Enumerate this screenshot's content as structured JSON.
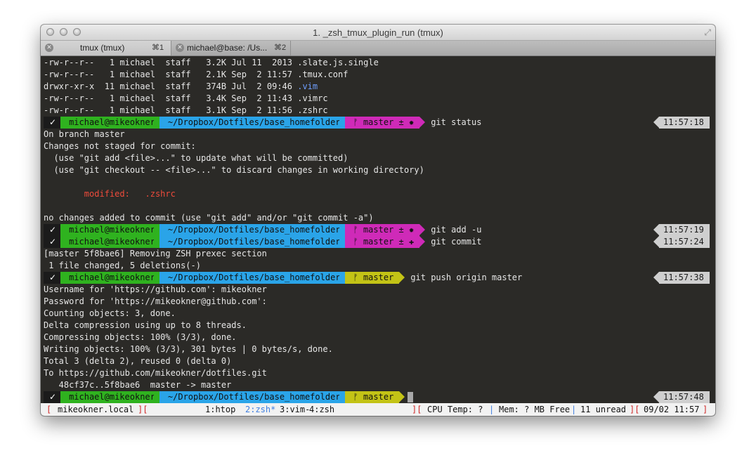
{
  "window": {
    "title": "1. _zsh_tmux_plugin_run (tmux)",
    "tabs": [
      {
        "label": "tmux (tmux)",
        "shortcut": "⌘1"
      },
      {
        "label": "michael@base: /Us...",
        "shortcut": "⌘2"
      }
    ]
  },
  "terminal": {
    "lines_top": [
      "-rw-r--r--   1 michael  staff   3.2K Jul 11  2013 .slate.js.single",
      "-rw-r--r--   1 michael  staff   2.1K Sep  2 11:57 .tmux.conf",
      "drwxr-xr-x  11 michael  staff   374B Jul  2 09:46 ",
      "-rw-r--r--   1 michael  staff   3.4K Sep  2 11:43 .vimrc",
      "-rw-r--r--   1 michael  staff   3.1K Sep  2 11:56 .zshrc"
    ],
    "vim_dir": ".vim",
    "status_output": [
      "On branch master",
      "Changes not staged for commit:",
      "  (use \"git add <file>...\" to update what will be committed)",
      "  (use \"git checkout -- <file>...\" to discard changes in working directory)",
      "no changes added to commit (use \"git add\" and/or \"git commit -a\")"
    ],
    "modified_line": "        modified:   .zshrc",
    "commit_output": [
      "[master 5f8bae6] Removing ZSH prexec section",
      " 1 file changed, 5 deletions(-)"
    ],
    "push_output": [
      "Username for 'https://github.com': mikeokner",
      "Password for 'https://mikeokner@github.com':",
      "Counting objects: 3, done.",
      "Delta compression using up to 8 threads.",
      "Compressing objects: 100% (3/3), done.",
      "Writing objects: 100% (3/3), 301 bytes | 0 bytes/s, done.",
      "Total 3 (delta 2), reused 0 (delta 0)",
      "To https://github.com/mikeokner/dotfiles.git",
      "   48cf37c..5f8bae6  master -> master"
    ],
    "prompts": [
      {
        "status": "✓",
        "user": "michael@mikeokner",
        "path": "~/Dropbox/Dotfiles/base_homefolder",
        "git": "ᚠ master ± ✹",
        "command": "git status",
        "time": "11:57:18"
      },
      {
        "status": "✓",
        "user": "michael@mikeokner",
        "path": "~/Dropbox/Dotfiles/base_homefolder",
        "git": "ᚠ master ± ✹",
        "command": "git add -u",
        "time": "11:57:19"
      },
      {
        "status": "✓",
        "user": "michael@mikeokner",
        "path": "~/Dropbox/Dotfiles/base_homefolder",
        "git": "ᚠ master ± ✚",
        "command": "git commit",
        "time": "11:57:24"
      },
      {
        "status": "✓",
        "user": "michael@mikeokner",
        "path": "~/Dropbox/Dotfiles/base_homefolder",
        "git": "ᚠ master",
        "command": "git push origin master",
        "time": "11:57:38"
      },
      {
        "status": "✓",
        "user": "michael@mikeokner",
        "path": "~/Dropbox/Dotfiles/base_homefolder",
        "git": "ᚠ master",
        "command": "",
        "time": "11:57:48"
      }
    ]
  },
  "tmux": {
    "host": "mikeokner.local",
    "windows": [
      {
        "label": "1:htop"
      },
      {
        "label": "2:zsh*"
      },
      {
        "label": "3:vim-"
      },
      {
        "label": "4:zsh"
      }
    ],
    "cpu": "CPU Temp: ?",
    "mem": "Mem: ? MB Free",
    "unread": "11 unread",
    "datetime": "09/02 11:57"
  },
  "colors": {
    "terminal_bg": "#2b2a27",
    "status_seg": "#1b1b1b",
    "user_seg": "#2fb21f",
    "path_seg": "#2aa4e8",
    "git_dirty_seg": "#cf2ab8",
    "git_clean_seg": "#c3c316",
    "time_seg": "#cfcfcf",
    "modified": "#ef4b3b",
    "dir_blue": "#6f9fff",
    "bracket_red": "#d02a2a"
  }
}
